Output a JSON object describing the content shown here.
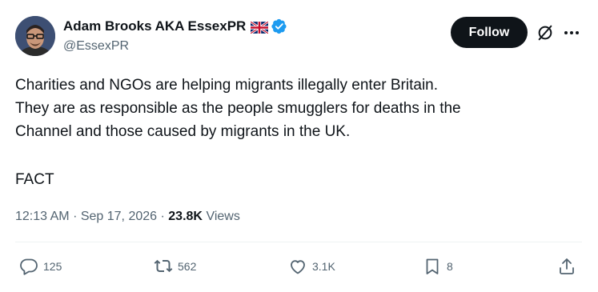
{
  "author": {
    "display_name": "Adam Brooks AKA EssexPR",
    "handle": "@EssexPR",
    "flag_icon": "uk-flag-icon",
    "verified_icon": "verified-badge-icon"
  },
  "header": {
    "follow_label": "Follow",
    "grok_icon": "grok-icon",
    "more_icon": "more-icon"
  },
  "tweet": {
    "lines": [
      "Charities and NGOs are helping migrants illegally enter Britain.",
      "They are as responsible as the people smugglers for deaths in the",
      "Channel and those caused by migrants in the UK."
    ],
    "fact": "FACT"
  },
  "meta": {
    "time": "12:13 AM",
    "separator": "·",
    "date": "Sep 17, 2026",
    "views_count": "23.8K",
    "views_label": "Views"
  },
  "actions": {
    "replies": "125",
    "reposts": "562",
    "likes": "3.1K",
    "bookmarks": "8"
  },
  "colors": {
    "text": "#0f1419",
    "secondary": "#536471",
    "verified": "#1d9bf0",
    "follow_bg": "#0f1419"
  }
}
